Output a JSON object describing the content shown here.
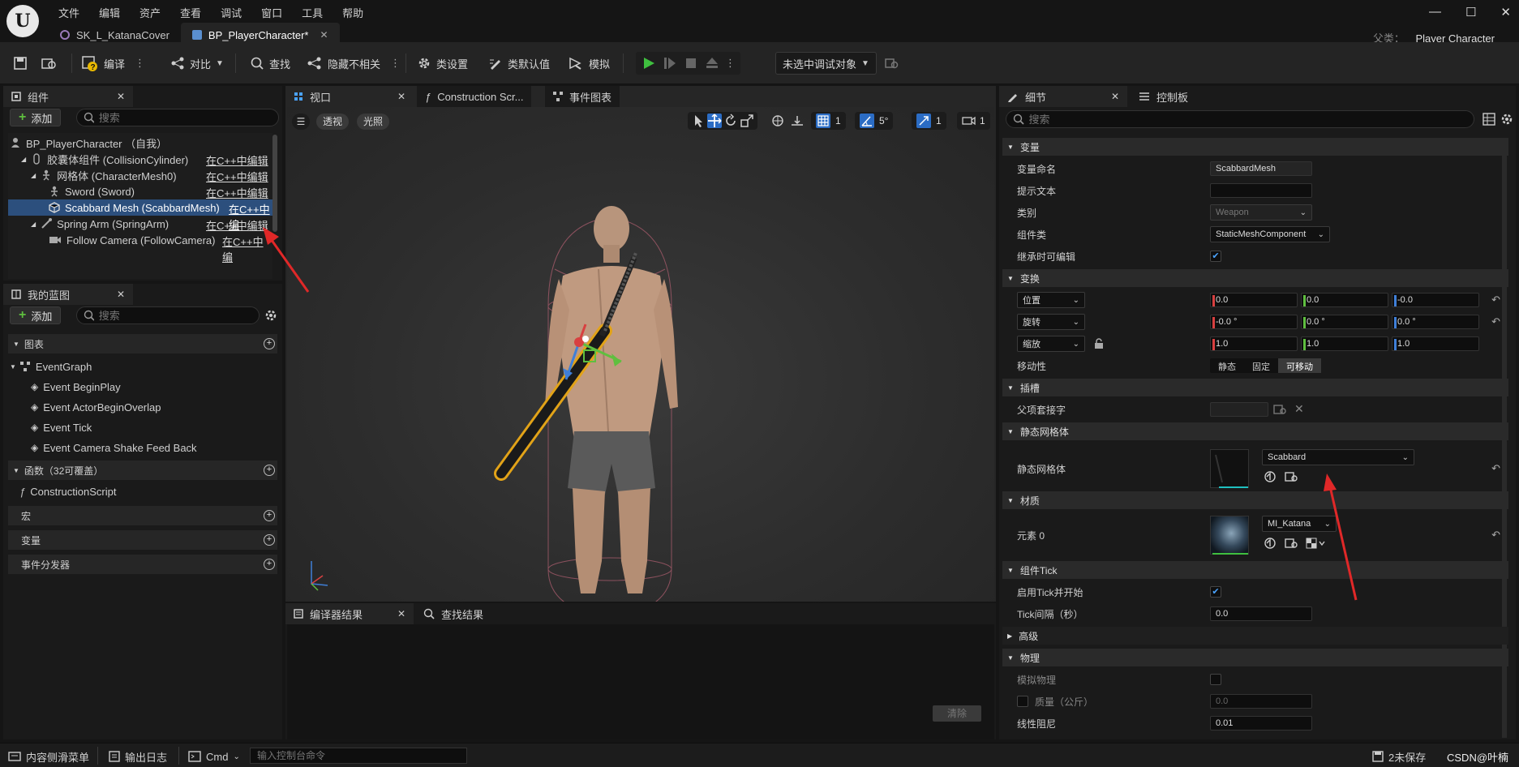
{
  "app": {
    "logo": "U"
  },
  "menu": [
    "文件",
    "编辑",
    "资产",
    "查看",
    "调试",
    "窗口",
    "工具",
    "帮助"
  ],
  "doc_tabs": [
    {
      "label": "SK_L_KatanaCover",
      "active": false
    },
    {
      "label": "BP_PlayerCharacter*",
      "active": true
    }
  ],
  "window_controls": {
    "minimize": "—",
    "maximize": "☐",
    "close": "✕"
  },
  "parent_class": {
    "label": "父类：",
    "value": "Player Character"
  },
  "toolbar": {
    "compile": "编译",
    "diff": "对比",
    "find": "查找",
    "hide_unrelated": "隐藏不相关",
    "class_settings": "类设置",
    "class_defaults": "类默认值",
    "simulate": "模拟",
    "debug_target": "未选中调试对象"
  },
  "components_panel": {
    "tab": "组件",
    "add": "添加",
    "search_placeholder": "搜索",
    "items": [
      {
        "label": "BP_PlayerCharacter （自我）",
        "link": ""
      },
      {
        "label": "胶囊体组件 (CollisionCylinder)",
        "link": "在C++中编辑"
      },
      {
        "label": "网格体 (CharacterMesh0)",
        "link": "在C++中编辑"
      },
      {
        "label": "Sword (Sword)",
        "link": "在C++中编辑"
      },
      {
        "label": "Scabbard Mesh (ScabbardMesh)",
        "link": "在C++中编"
      },
      {
        "label": "Spring Arm (SpringArm)",
        "link": "在C++中编辑"
      },
      {
        "label": "Follow Camera (FollowCamera)",
        "link": "在C++中编"
      }
    ]
  },
  "myblueprint_panel": {
    "tab": "我的蓝图",
    "add": "添加",
    "search_placeholder": "搜索",
    "graphs_header": "图表",
    "event_graph": "EventGraph",
    "events": [
      "Event BeginPlay",
      "Event ActorBeginOverlap",
      "Event Tick",
      "Event Camera Shake Feed Back"
    ],
    "functions_header": "函数（32可覆盖）",
    "construction": "ConstructionScript",
    "macros": "宏",
    "variables": "变量",
    "dispatchers": "事件分发器"
  },
  "viewport": {
    "tabs": [
      "视口",
      "Construction Scr...",
      "事件图表"
    ],
    "perspective": "透视",
    "lit": "光照",
    "grid": "1",
    "angle": "5°",
    "scale": "1",
    "camera": "1"
  },
  "compiler": {
    "tabs": [
      "编译器结果",
      "查找结果"
    ],
    "clear": "清除"
  },
  "details": {
    "tabs": [
      "细节",
      "控制板"
    ],
    "search_placeholder": "搜索",
    "sections": {
      "variable": "变量",
      "transform": "变换",
      "sockets": "插槽",
      "static_mesh": "静态网格体",
      "materials": "材质",
      "tick": "组件Tick",
      "advanced": "高级",
      "physics": "物理"
    },
    "variable_name_label": "变量命名",
    "variable_name": "ScabbardMesh",
    "tooltip_label": "提示文本",
    "tooltip": "",
    "category_label": "类别",
    "category": "Weapon",
    "component_class_label": "组件类",
    "component_class": "StaticMeshComponent",
    "editable_label": "继承时可编辑",
    "location_label": "位置",
    "location": [
      "0.0",
      "0.0",
      "-0.0"
    ],
    "rotation_label": "旋转",
    "rotation": [
      "-0.0 °",
      "0.0 °",
      "0.0 °"
    ],
    "scale_label": "缩放",
    "scale": [
      "1.0",
      "1.0",
      "1.0"
    ],
    "mobility_label": "移动性",
    "mobility": [
      "静态",
      "固定",
      "可移动"
    ],
    "parent_socket_label": "父项套接字",
    "static_mesh_label": "静态网格体",
    "static_mesh": "Scabbard",
    "element0_label": "元素 0",
    "material": "MI_Katana",
    "tick_start_label": "启用Tick并开始",
    "tick_interval_label": "Tick间隔（秒）",
    "tick_interval": "0.0",
    "simulate_physics_label": "模拟物理",
    "mass_label": "质量（公斤）",
    "mass": "0.0",
    "linear_damping_label": "线性阻尼",
    "linear_damping": "0.01"
  },
  "statusbar": {
    "content_drawer": "内容侧滑菜单",
    "output_log": "输出日志",
    "cmd": "Cmd",
    "console_placeholder": "输入控制台命令",
    "unsaved": "2未保存",
    "source": "CSDN@叶楠"
  },
  "colors": {
    "accent": "#2c4f7d",
    "play": "#3fbf3f",
    "x_axis": "#d84040",
    "y_axis": "#5fbf3f",
    "z_axis": "#3f7fd8",
    "annotation": "#e02828"
  }
}
